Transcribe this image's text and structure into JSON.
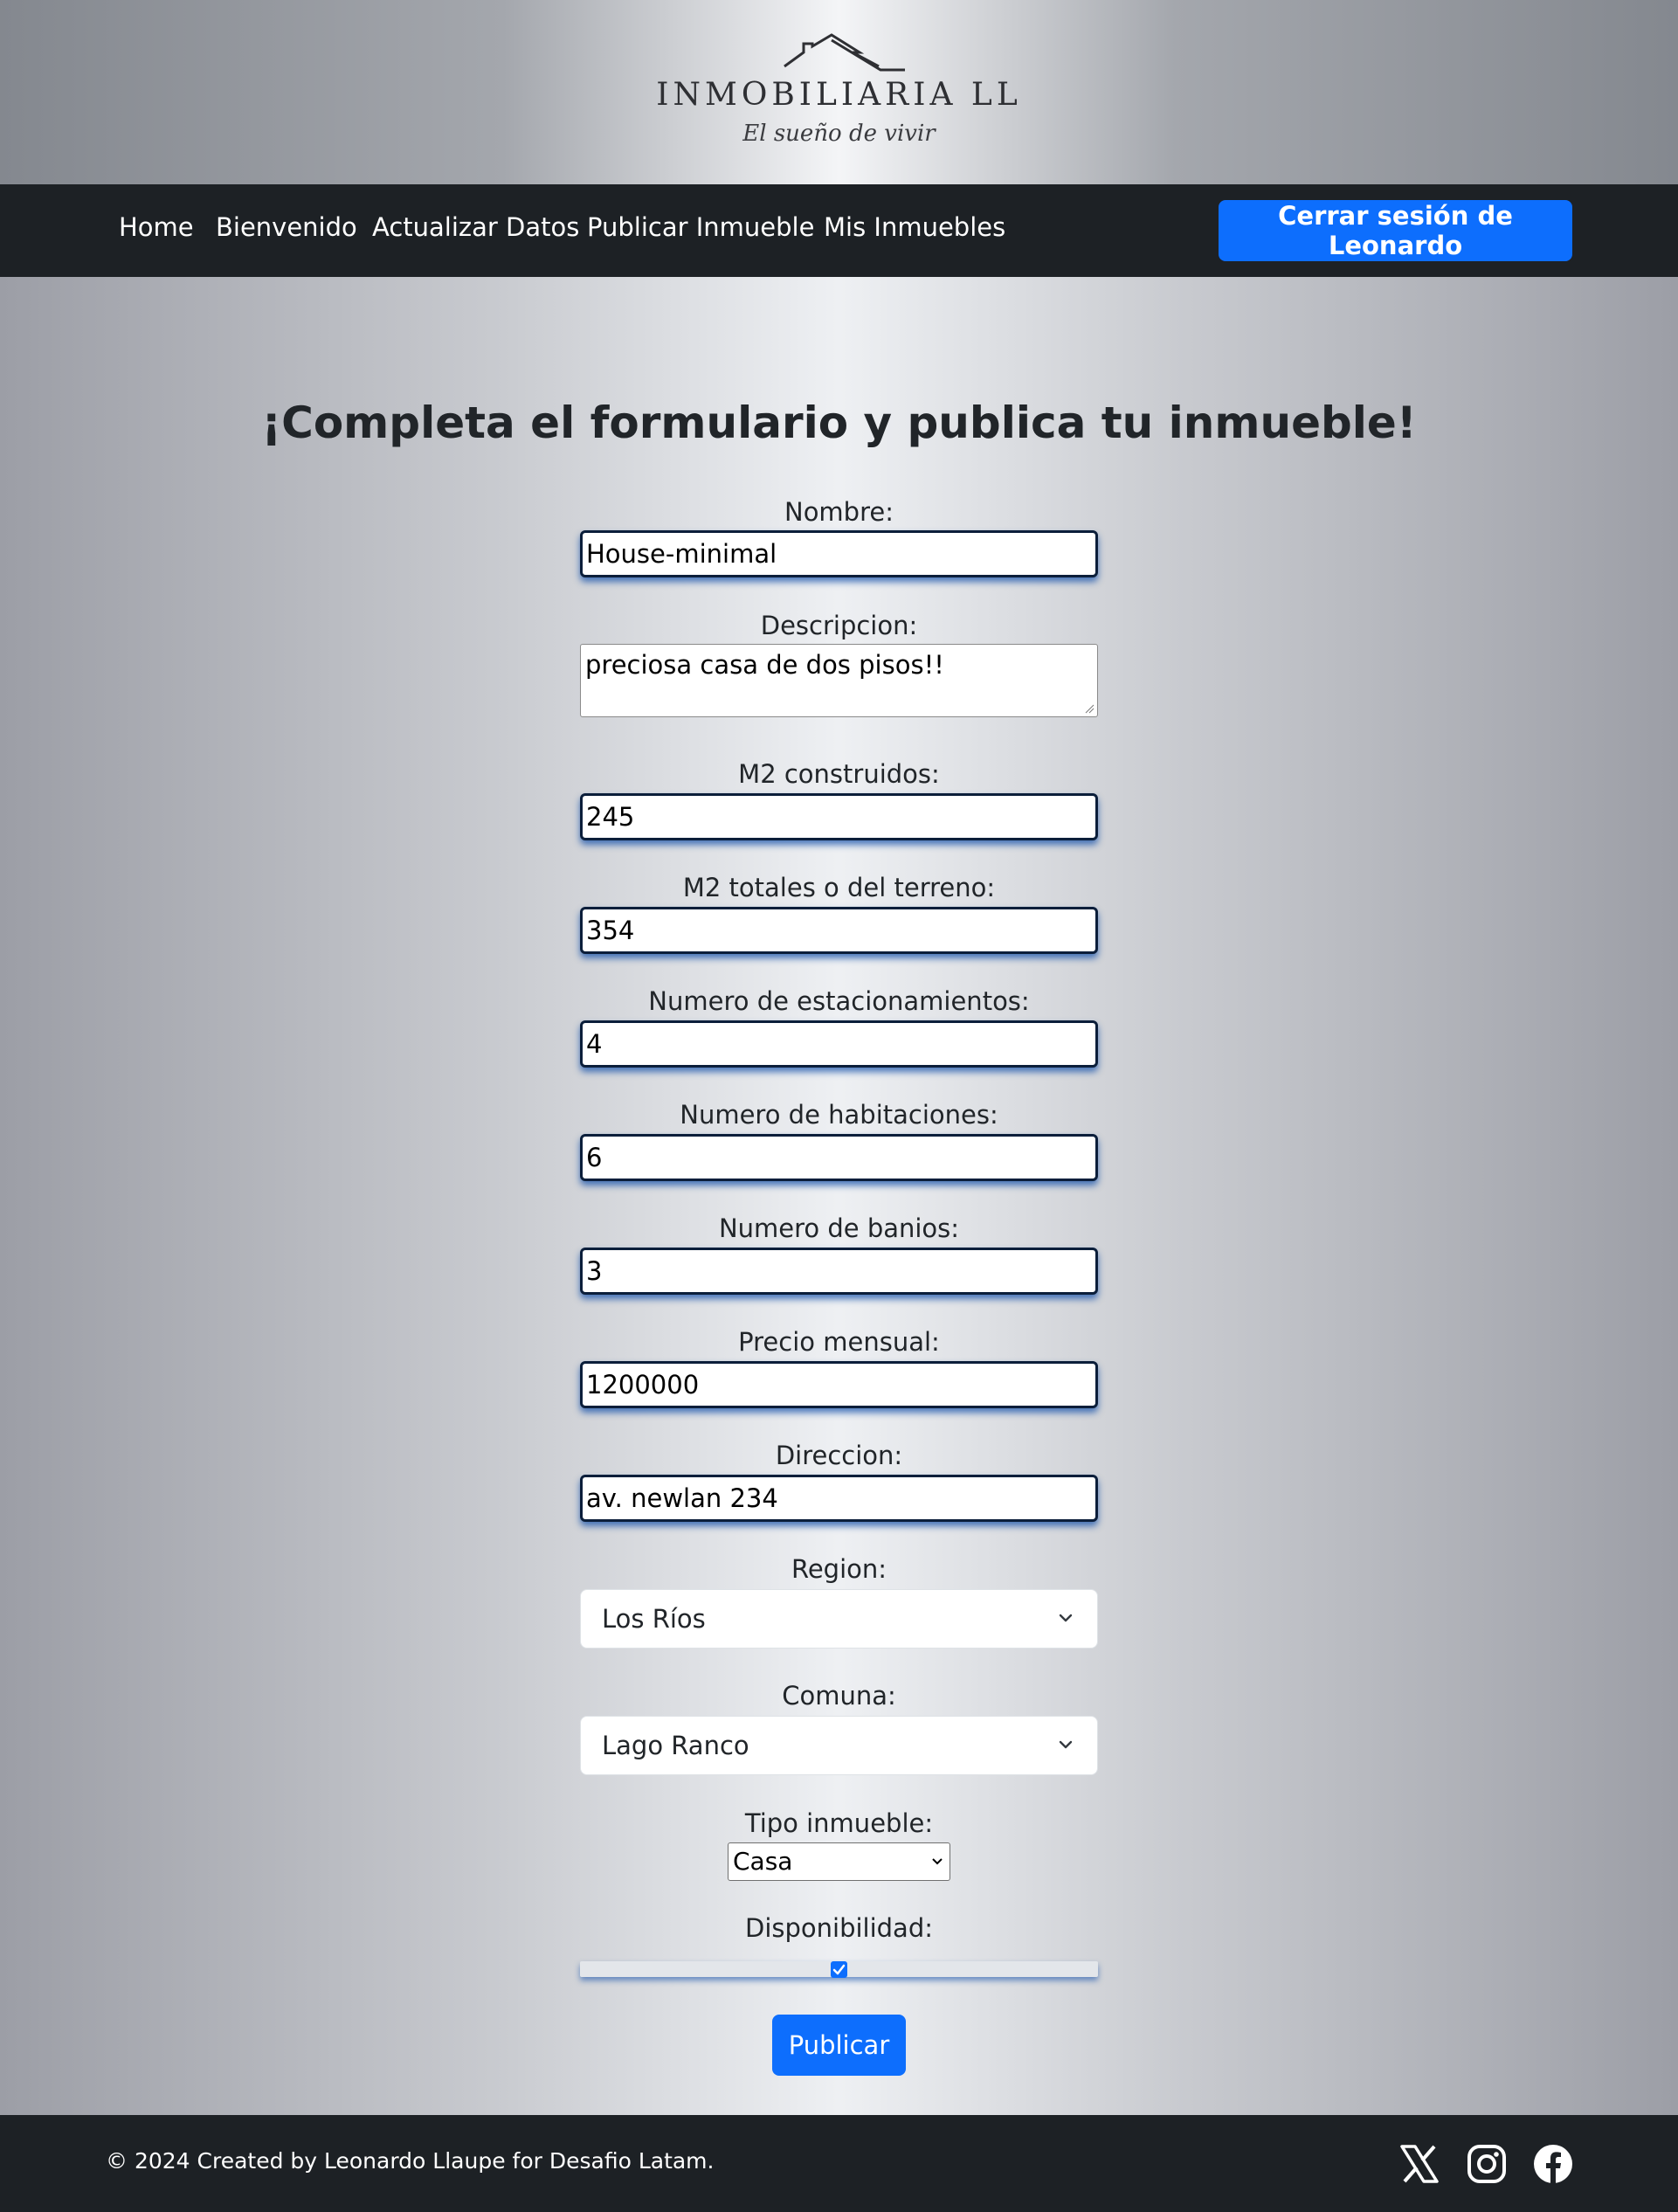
{
  "brand": {
    "name": "INMOBILIARIA LL",
    "tagline": "El sueño de vivir"
  },
  "nav": {
    "items": [
      {
        "label": "Home"
      },
      {
        "label": "Bienvenido"
      },
      {
        "label": "Actualizar Datos"
      },
      {
        "label": "Publicar Inmueble"
      },
      {
        "label": "Mis Inmuebles"
      }
    ],
    "logout_label": "Cerrar sesión de Leonardo"
  },
  "form": {
    "title": "¡Completa el formulario y publica tu inmueble!",
    "nombre": {
      "label": "Nombre:",
      "value": "House-minimal"
    },
    "descripcion": {
      "label": "Descripcion:",
      "value": "preciosa casa de dos pisos!!"
    },
    "m2_construidos": {
      "label": "M2 construidos:",
      "value": "245"
    },
    "m2_totales": {
      "label": "M2 totales o del terreno:",
      "value": "354"
    },
    "estacionamientos": {
      "label": "Numero de estacionamientos:",
      "value": "4"
    },
    "habitaciones": {
      "label": "Numero de habitaciones:",
      "value": "6"
    },
    "banios": {
      "label": "Numero de banios:",
      "value": "3"
    },
    "precio": {
      "label": "Precio mensual:",
      "value": "1200000"
    },
    "direccion": {
      "label": "Direccion:",
      "value": "av. newlan 234"
    },
    "region": {
      "label": "Region:",
      "selected": "Los Ríos"
    },
    "comuna": {
      "label": "Comuna:",
      "selected": "Lago Ranco"
    },
    "tipo": {
      "label": "Tipo inmueble:",
      "selected": "Casa"
    },
    "disponibilidad": {
      "label": "Disponibilidad:",
      "checked": true
    },
    "submit_label": "Publicar"
  },
  "footer": {
    "text": "© 2024 Created by Leonardo Llaupe for Desafio Latam.",
    "social_icons": [
      "x-icon",
      "instagram-icon",
      "facebook-icon"
    ]
  },
  "colors": {
    "primary": "#0d6efd",
    "navbar": "#1d2125",
    "input_border": "#0b1e3a"
  }
}
